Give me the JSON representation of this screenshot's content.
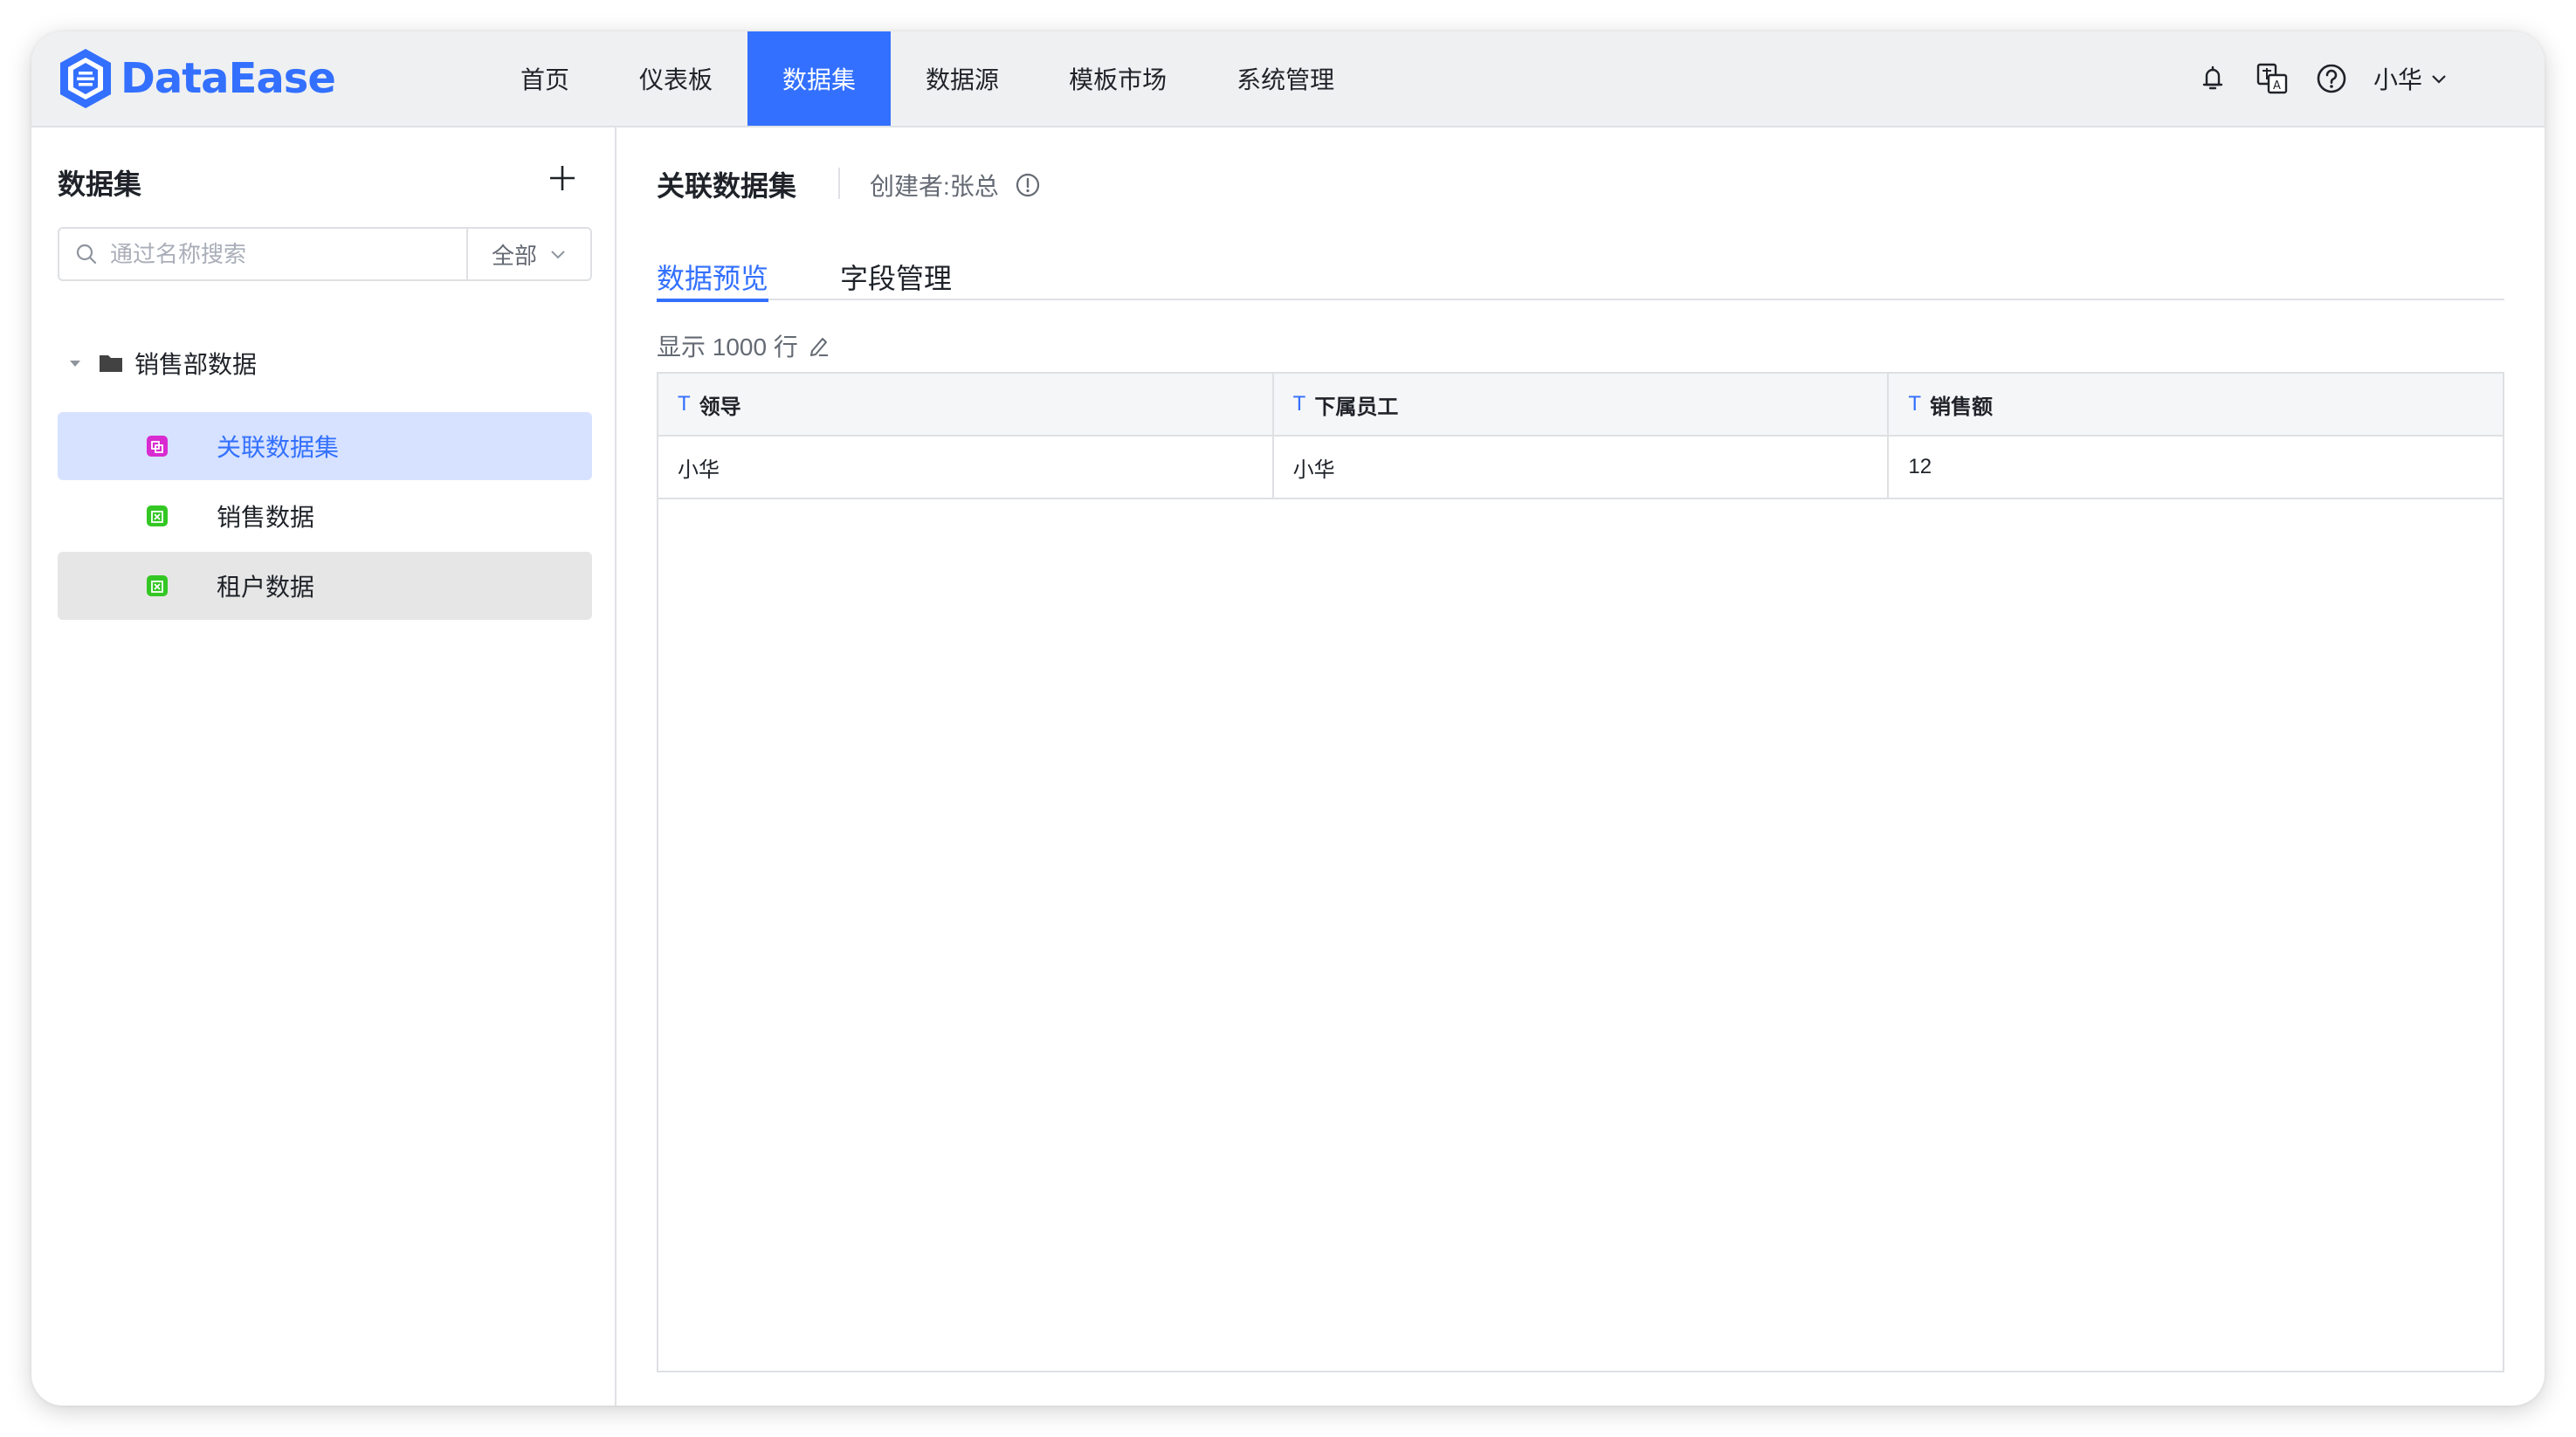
{
  "app": {
    "logo_text": "DataEase",
    "accent": "#3370ff"
  },
  "nav": {
    "items": [
      {
        "label": "首页",
        "active": false
      },
      {
        "label": "仪表板",
        "active": false
      },
      {
        "label": "数据集",
        "active": true
      },
      {
        "label": "数据源",
        "active": false
      },
      {
        "label": "模板市场",
        "active": false
      },
      {
        "label": "系统管理",
        "active": false
      }
    ]
  },
  "top_right": {
    "icons": [
      "notification-icon",
      "translate-icon",
      "help-icon"
    ],
    "user_name": "小华"
  },
  "sidebar": {
    "title": "数据集",
    "search": {
      "placeholder": "通过名称搜索",
      "value": "",
      "filter": "全部"
    },
    "folder": {
      "label": "销售部数据",
      "expanded": true
    },
    "items": [
      {
        "label": "关联数据集",
        "icon": "union-dataset-icon",
        "color": "#d82bd0",
        "selected": true
      },
      {
        "label": "销售数据",
        "icon": "excel-dataset-icon",
        "color": "#34c724",
        "selected": false
      },
      {
        "label": "租户数据",
        "icon": "excel-dataset-icon",
        "color": "#34c724",
        "selected": false
      }
    ]
  },
  "main": {
    "title": "关联数据集",
    "creator": "创建者:张总",
    "tabs": [
      {
        "label": "数据预览",
        "active": true
      },
      {
        "label": "字段管理",
        "active": false
      }
    ],
    "rows_info": "显示 1000 行",
    "table": {
      "type_marker": "T",
      "columns": [
        "领导",
        "下属员工",
        "销售额"
      ],
      "rows": [
        [
          "小华",
          "小华",
          "12"
        ]
      ]
    }
  }
}
